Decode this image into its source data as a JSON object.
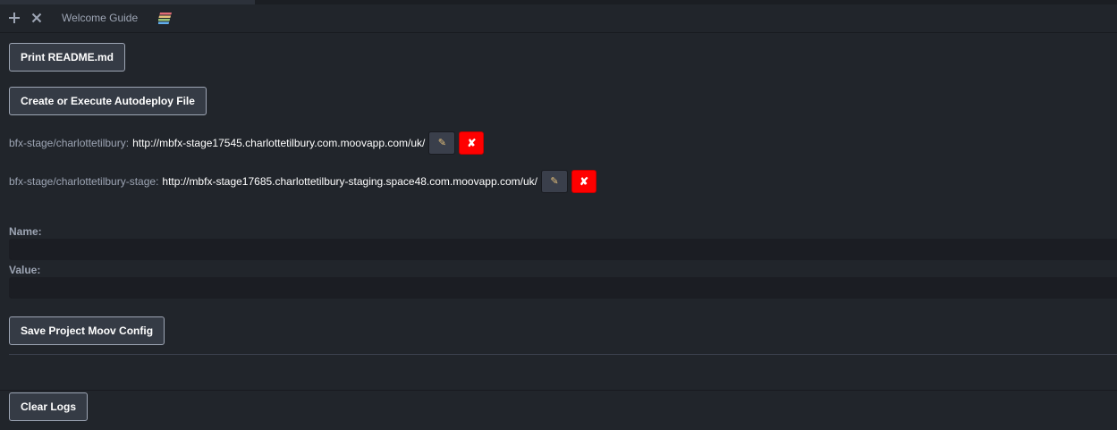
{
  "tab_bar": {
    "new_tab_icon": "plus-icon",
    "close_icon": "close-icon",
    "tab_title": "Welcome Guide",
    "logo_icon": "rainbow-stack-icon",
    "logo_colors": [
      "#e06c75",
      "#e5c07b",
      "#98c379",
      "#61afef"
    ]
  },
  "actions": {
    "print_readme_label": "Print README.md",
    "autodeploy_label": "Create or Execute Autodeploy File"
  },
  "environments": [
    {
      "name": "bfx-stage/charlottetilbury:",
      "url": "http://mbfx-stage17545.charlottetilbury.com.moovapp.com/uk/",
      "edit_icon": "pencil-icon",
      "delete_icon": "x-icon"
    },
    {
      "name": "bfx-stage/charlottetilbury-stage:",
      "url": "http://mbfx-stage17685.charlottetilbury-staging.space48.com.moovapp.com/uk/",
      "edit_icon": "pencil-icon",
      "delete_icon": "x-icon"
    }
  ],
  "form": {
    "name_label": "Name:",
    "name_value": "",
    "value_label": "Value:",
    "value_value": "",
    "save_label": "Save Project Moov Config"
  },
  "logs": {
    "clear_label": "Clear Logs"
  },
  "colors": {
    "background": "#21252b",
    "button_border": "#9da5b4",
    "delete_red": "#ff0000",
    "edit_pencil": "#e5c07b"
  }
}
